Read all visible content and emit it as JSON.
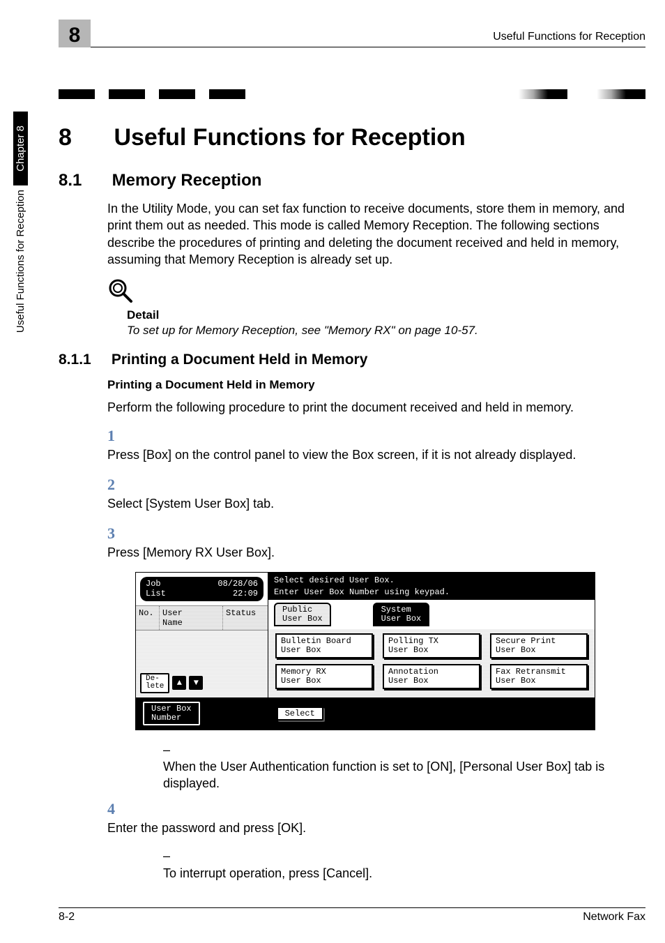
{
  "header": {
    "chapter_num_small": "8",
    "running_head_right": "Useful Functions for Reception"
  },
  "side_tab": {
    "chapter_label": "Chapter 8",
    "section_label": "Useful Functions for Reception"
  },
  "h1": {
    "num": "8",
    "title": "Useful Functions for Reception"
  },
  "h2": {
    "num": "8.1",
    "title": "Memory Reception"
  },
  "p1": "In the Utility Mode, you can set fax function to receive documents, store them in memory, and print them out as needed. This mode is called Memory Reception. The following sections describe the procedures of printing and deleting the document received and held in memory, assuming that Memory Reception is already set up.",
  "detail": {
    "label": "Detail",
    "text": "To set up for Memory Reception, see \"Memory RX\" on page 10-57."
  },
  "h3": {
    "num": "8.1.1",
    "title": "Printing a Document Held in Memory"
  },
  "subhead": "Printing a Document Held in Memory",
  "p2": "Perform the following procedure to print the document received and held in memory.",
  "steps": {
    "s1n": "1",
    "s1t": "Press [Box] on the control panel to view the Box screen, if it is not already displayed.",
    "s2n": "2",
    "s2t": "Select [System User Box] tab.",
    "s3n": "3",
    "s3t": "Press [Memory RX User Box].",
    "s4n": "4",
    "s4t": "Enter the password and press [OK]."
  },
  "bullets": {
    "b1": "When the User Authentication function is set to [ON], [Personal User Box] tab is displayed.",
    "b2": "To interrupt operation, press [Cancel]."
  },
  "lcd": {
    "job_list": "Job\nList",
    "datetime": "08/28/06\n22:09",
    "col_no": "No.",
    "col_user": "User\nName",
    "col_status": "Status",
    "delete": "De-\nlete",
    "arrow_up": "▲",
    "arrow_down": "▼",
    "msg1": "Select desired User Box.",
    "msg2": "Enter User Box Number using keypad.",
    "tab_public": "Public\nUser Box",
    "tab_system": "System\nUser Box",
    "btn_bulletin": "Bulletin Board\nUser Box",
    "btn_polling": "Polling TX\nUser Box",
    "btn_secure": "Secure Print\nUser Box",
    "btn_memory": "Memory RX\nUser Box",
    "btn_annotation": "Annotation\nUser Box",
    "btn_retransmit": "Fax Retransmit\nUser Box",
    "footer_userbox": "User Box\nNumber",
    "footer_select": "Select"
  },
  "footer": {
    "page": "8-2",
    "doc": "Network Fax"
  }
}
